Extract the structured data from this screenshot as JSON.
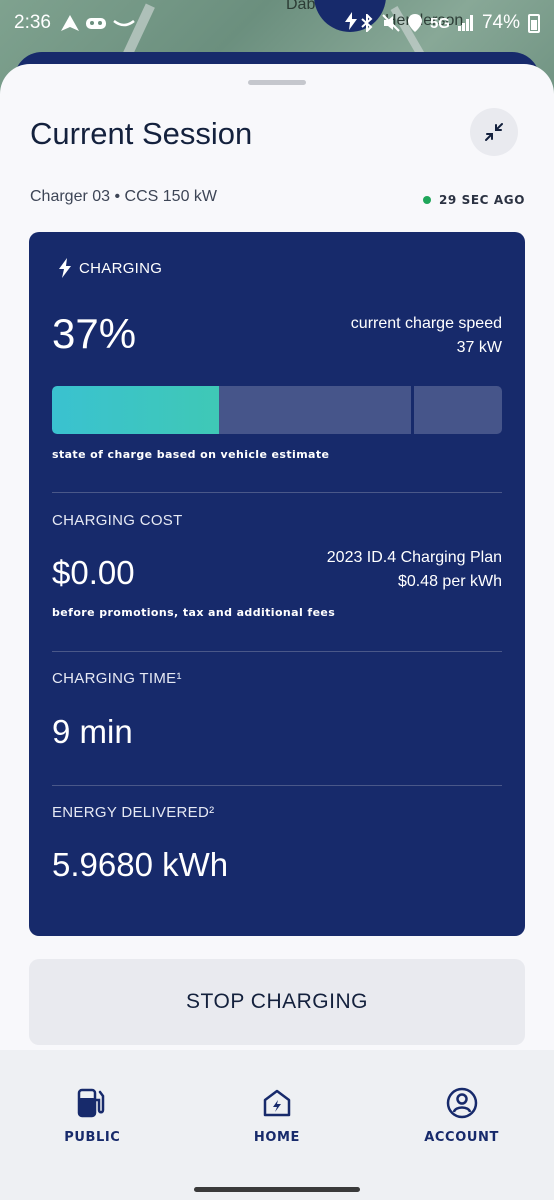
{
  "status_bar": {
    "time": "2:36",
    "network": "5G",
    "battery": "74%"
  },
  "map": {
    "label_1": "Dab",
    "label_2": "Henderson"
  },
  "session": {
    "title": "Current Session",
    "charger": "Charger 03 • CCS 150 kW",
    "updated": "29 SEC AGO"
  },
  "card": {
    "status_label": "CHARGING",
    "state_of_charge": "37%",
    "speed_label": "current charge speed",
    "speed_value": "37 kW",
    "progress_fraction": 0.37,
    "soc_note": "state of charge based on vehicle estimate",
    "cost_label": "CHARGING COST",
    "cost_value": "$0.00",
    "plan_name": "2023 ID.4 Charging Plan",
    "plan_rate": "$0.48 per kWh",
    "fee_note": "before promotions, tax and additional fees",
    "time_label": "CHARGING TIME¹",
    "time_value": "9 min",
    "energy_label": "ENERGY DELIVERED²",
    "energy_value": "5.9680 kWh"
  },
  "actions": {
    "stop_label": "STOP CHARGING"
  },
  "nav": {
    "items": [
      {
        "label": "PUBLIC",
        "icon": "fuel-pump-icon"
      },
      {
        "label": "HOME",
        "icon": "home-charger-icon"
      },
      {
        "label": "ACCOUNT",
        "icon": "account-icon"
      }
    ]
  },
  "colors": {
    "primary": "#172a6b",
    "progress": "#3fc8b6",
    "live_dot": "#1fa65a"
  }
}
